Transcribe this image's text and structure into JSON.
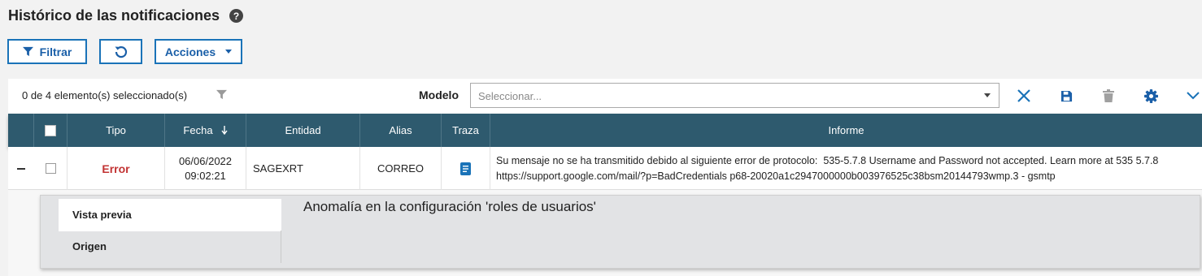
{
  "header": {
    "title": "Histórico de las notificaciones",
    "help_icon": "?"
  },
  "buttons": {
    "filter_label": "Filtrar",
    "actions_label": "Acciones"
  },
  "toolbar": {
    "selection_text": "0 de 4 elemento(s) seleccionado(s)",
    "modelo_label": "Modelo",
    "modelo_placeholder": "Seleccionar..."
  },
  "colors": {
    "header_bg": "#2e5a6e",
    "accent": "#1a73b8",
    "error": "#c23333"
  },
  "columns": [
    "Tipo",
    "Fecha",
    "Entidad",
    "Alias",
    "Traza",
    "Informe"
  ],
  "rows": [
    {
      "tipo": "Error",
      "fecha_date": "06/06/2022",
      "fecha_time": "09:02:21",
      "entidad": "SAGEXRT",
      "alias": "CORREO",
      "informe_line1": "Su mensaje no se ha transmitido debido al siguiente error de protocolo:  535-5.7.8 Username and Password not accepted. Learn more at 535 5.7.8",
      "informe_line2": "https://support.google.com/mail/?p=BadCredentials p68-20020a1c2947000000b003976525c38bsm20144793wmp.3 - gsmtp"
    }
  ],
  "detail": {
    "tabs": [
      "Vista previa",
      "Origen"
    ],
    "preview_text": "Anomalía en la configuración 'roles de usuarios'"
  }
}
